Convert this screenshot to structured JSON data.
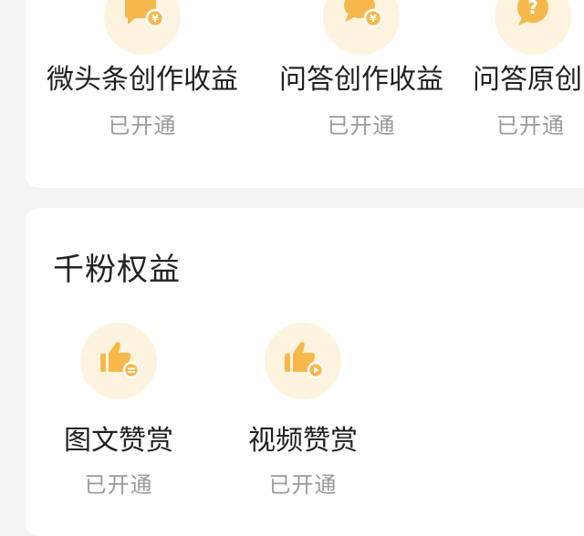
{
  "top_section": {
    "items": [
      {
        "label": "微头条创作收益",
        "status": "已开通",
        "icon": "chat-bubble-yuan-icon"
      },
      {
        "label": "问答创作收益",
        "status": "已开通",
        "icon": "round-bubble-yuan-icon"
      },
      {
        "label": "问答原创",
        "status": "已开通",
        "icon": "question-bubble-icon"
      }
    ]
  },
  "fans_section": {
    "title": "千粉权益",
    "items": [
      {
        "label": "图文赞赏",
        "status": "已开通",
        "icon": "thumbs-up-document-icon"
      },
      {
        "label": "视频赞赏",
        "status": "已开通",
        "icon": "thumbs-up-play-icon"
      }
    ]
  },
  "colors": {
    "background": "#f4f4f4",
    "card": "#ffffff",
    "icon_halo": "#fdf3df",
    "icon_accent": "#f7b84b",
    "label_text": "#1f1f1f",
    "status_text": "#9b9b9b"
  }
}
